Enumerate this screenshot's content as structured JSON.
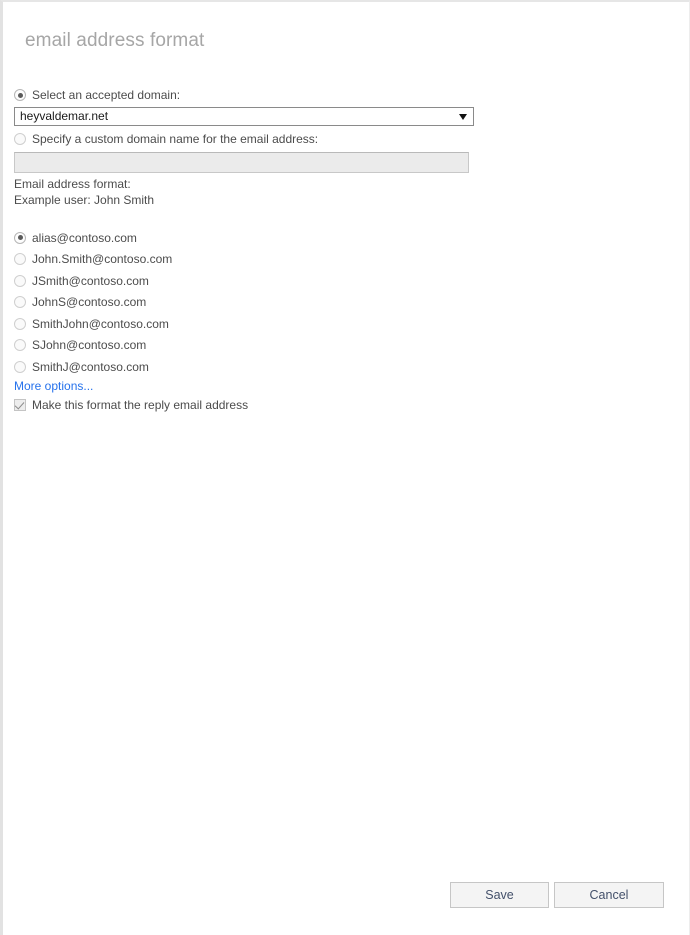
{
  "dialog": {
    "title": "email address format"
  },
  "domain": {
    "select_accepted_label": "Select an accepted domain:",
    "selected_domain": "heyvaldemar.net",
    "custom_domain_label": "Specify a custom domain name for the email address:",
    "custom_domain_value": "",
    "custom_domain_placeholder": ""
  },
  "format_section": {
    "heading": "Email address format:",
    "example_user": "Example user: John Smith",
    "options": [
      {
        "label": "alias@contoso.com",
        "selected": true
      },
      {
        "label": "John.Smith@contoso.com",
        "selected": false
      },
      {
        "label": "JSmith@contoso.com",
        "selected": false
      },
      {
        "label": "JohnS@contoso.com",
        "selected": false
      },
      {
        "label": "SmithJohn@contoso.com",
        "selected": false
      },
      {
        "label": "SJohn@contoso.com",
        "selected": false
      },
      {
        "label": "SmithJ@contoso.com",
        "selected": false
      }
    ],
    "more_options_link": "More options...",
    "reply_address_checkbox": "Make this format the reply email address"
  },
  "footer": {
    "save_label": "Save",
    "cancel_label": "Cancel"
  },
  "colors": {
    "link": "#2672ec",
    "title": "#a6a6a6",
    "text": "#4c4c4c",
    "button_text": "#43506a"
  }
}
